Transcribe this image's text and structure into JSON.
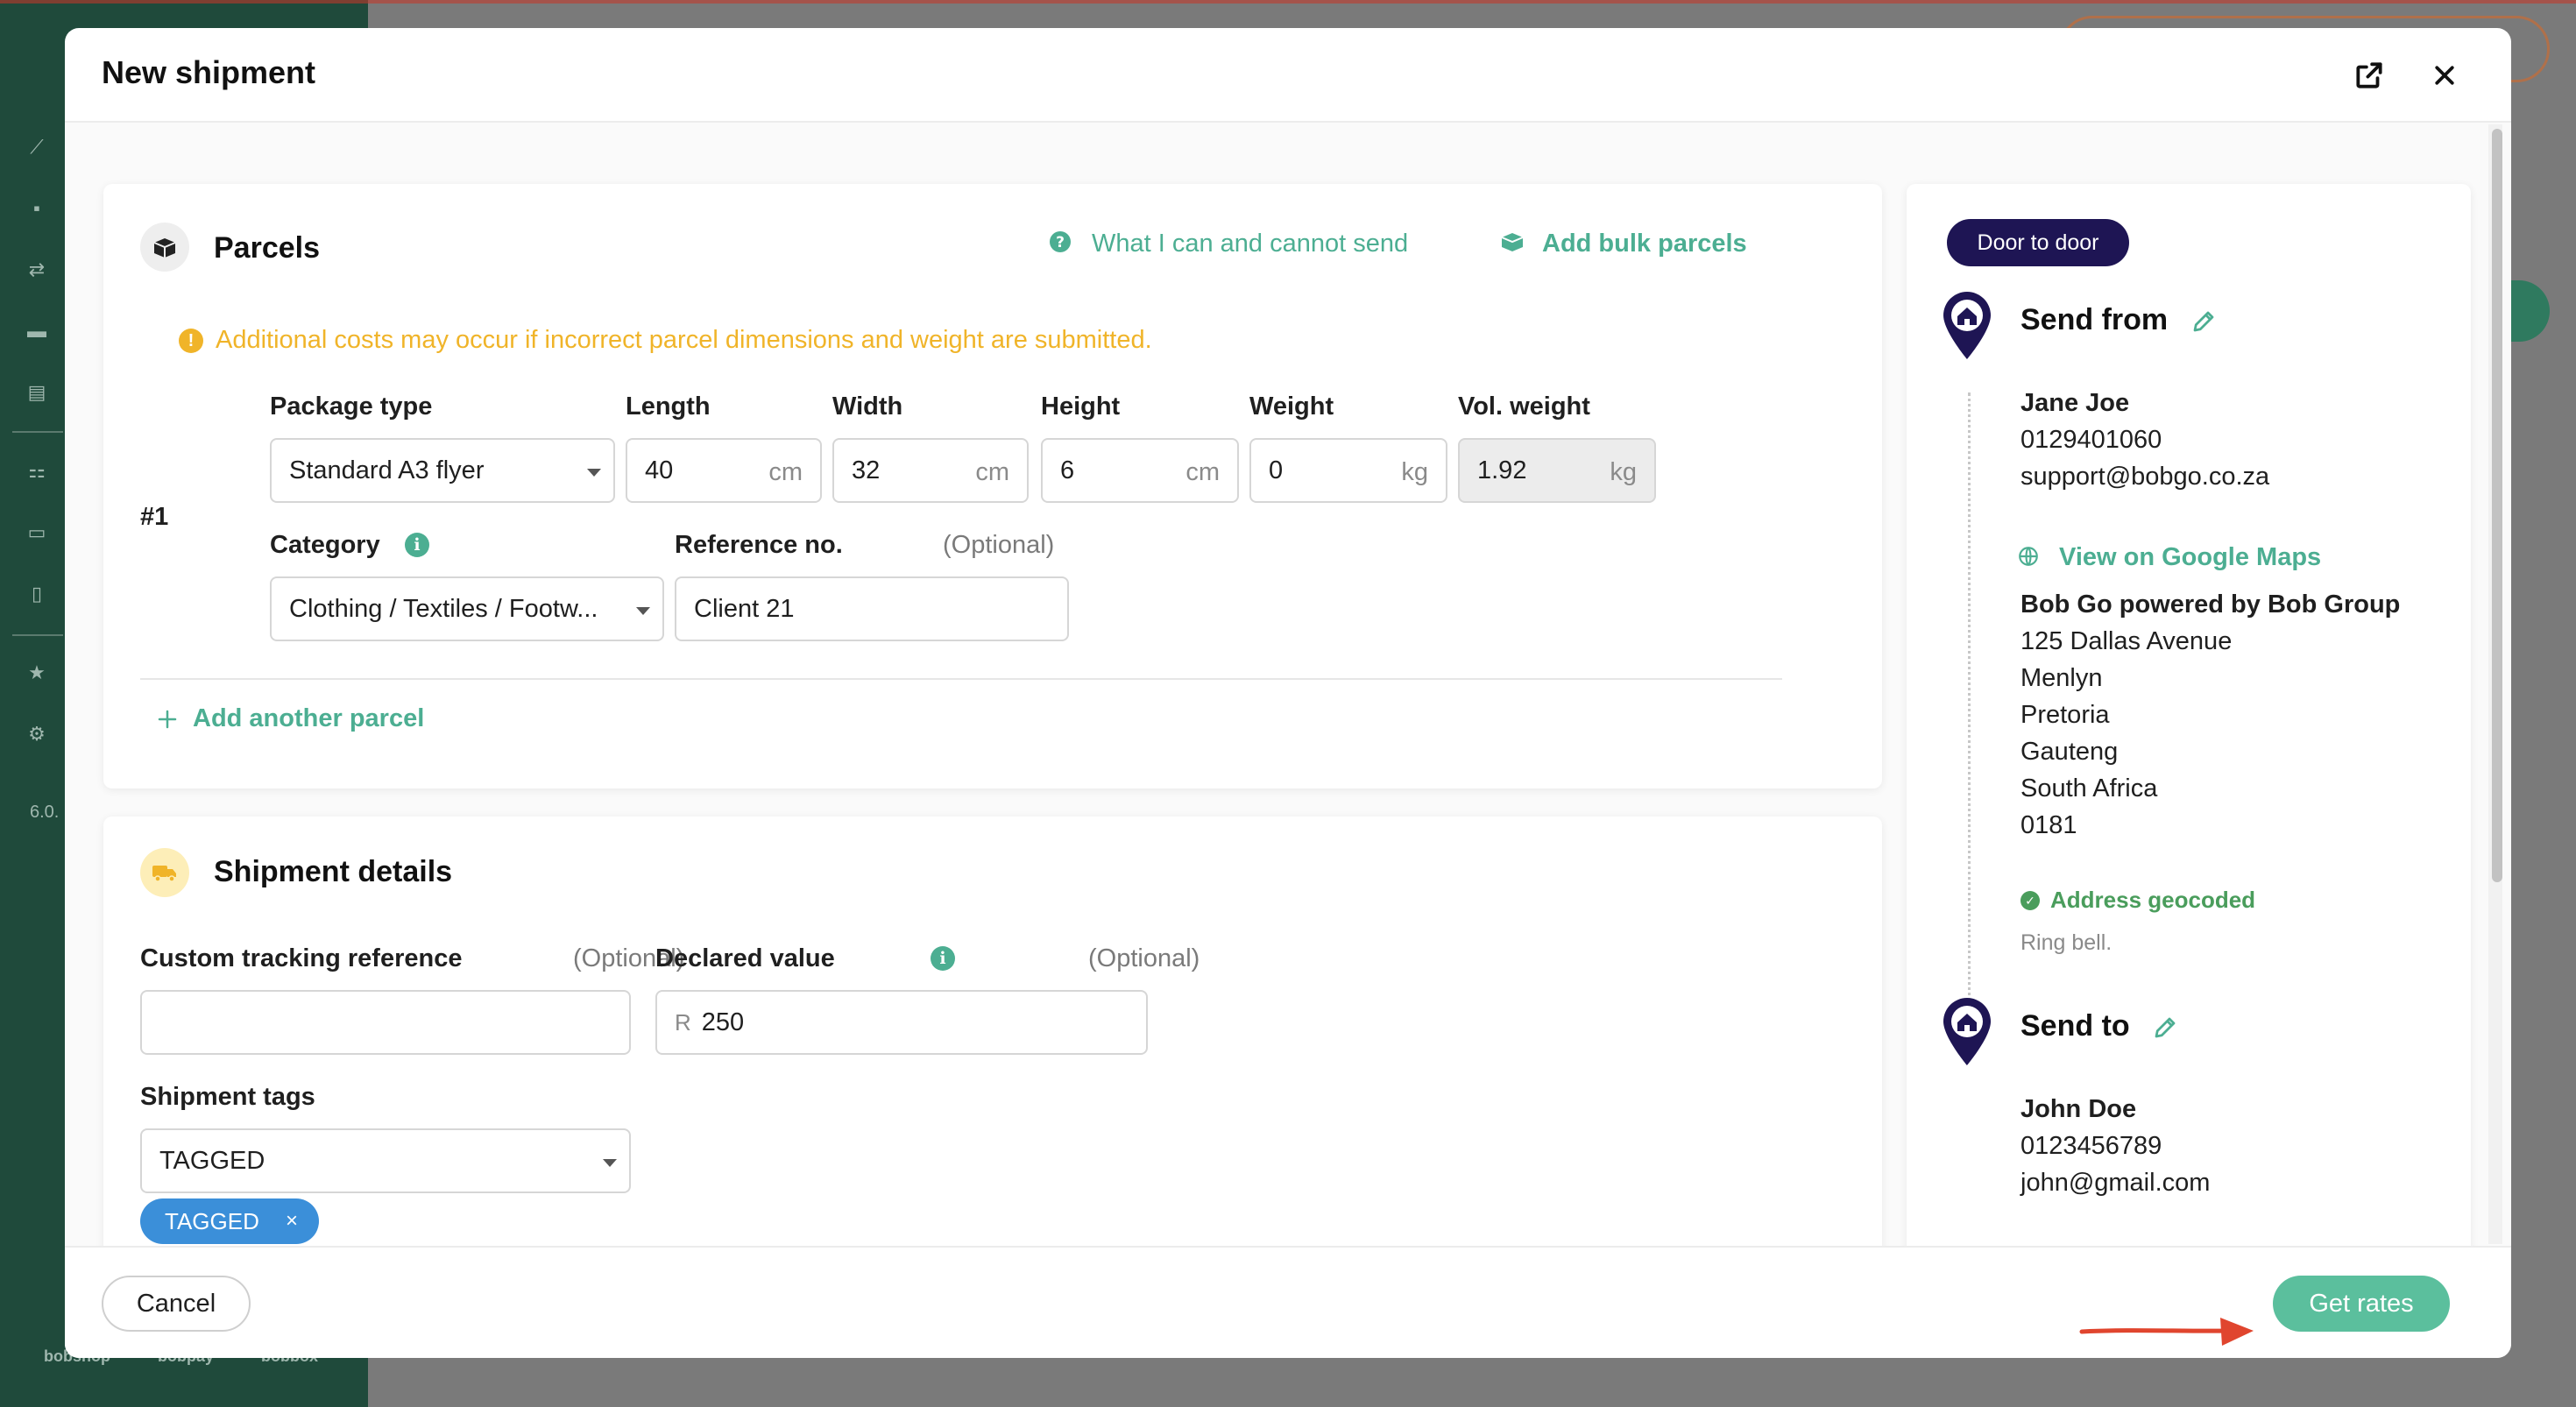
{
  "modal": {
    "title": "New shipment"
  },
  "parcels": {
    "title": "Parcels",
    "what_link": "What I can and cannot send",
    "bulk_link": "Add bulk parcels",
    "warning": "Additional costs may occur if incorrect parcel dimensions and weight are submitted.",
    "index": "#1",
    "labels": {
      "package_type": "Package type",
      "length": "Length",
      "width": "Width",
      "height": "Height",
      "weight": "Weight",
      "vol_weight": "Vol. weight",
      "category": "Category",
      "reference": "Reference no.",
      "optional": "(Optional)"
    },
    "values": {
      "package_type": "Standard A3 flyer",
      "length": "40",
      "width": "32",
      "height": "6",
      "weight": "0",
      "vol_weight": "1.92",
      "category": "Clothing / Textiles / Footw...",
      "reference": "Client 21"
    },
    "units": {
      "cm": "cm",
      "kg": "kg"
    },
    "add_another": "Add another parcel"
  },
  "shipment_details": {
    "title": "Shipment details",
    "labels": {
      "tracking": "Custom tracking reference",
      "declared": "Declared value",
      "optional": "(Optional)",
      "tags": "Shipment tags"
    },
    "values": {
      "tracking": "",
      "currency": "R",
      "declared": "250",
      "tags_select": "TAGGED",
      "tag_chip": "TAGGED",
      "tag_remove": "×"
    }
  },
  "route": {
    "service": "Door to door",
    "from": {
      "title": "Send from",
      "name": "Jane Joe",
      "phone": "0129401060",
      "email": "support@bobgo.co.za",
      "maps_link": "View on Google Maps",
      "company": "Bob Go powered by Bob Group",
      "street": "125 Dallas Avenue",
      "suburb": "Menlyn",
      "city": "Pretoria",
      "province": "Gauteng",
      "country": "South Africa",
      "postal": "0181",
      "geocoded": "Address geocoded",
      "note": "Ring bell."
    },
    "to": {
      "title": "Send to",
      "name": "John Doe",
      "phone": "0123456789",
      "email": "john@gmail.com"
    }
  },
  "footer": {
    "cancel": "Cancel",
    "get_rates": "Get rates"
  },
  "background": {
    "version": "6.0.",
    "brands": [
      "bobshop",
      "bobpay",
      "bobbox"
    ]
  },
  "colors": {
    "accent": "#4cae92",
    "primary_button": "#5bbf9d",
    "warning": "#f0b429",
    "service_pill": "#1e1554",
    "tag_chip": "#3b8fd9",
    "geocoded": "#4a9d5c",
    "annotation_arrow": "#e0452e"
  },
  "icons": {
    "external": "external-link-icon",
    "close": "close-icon",
    "parcels": "parcels-box-icon",
    "help": "help-circle-icon",
    "bulk": "boxes-icon",
    "warning": "warning-icon",
    "info": "info-icon",
    "plus": "plus-icon",
    "truck": "truck-icon",
    "pin": "home-pin-icon",
    "pencil": "pencil-icon",
    "globe": "globe-icon",
    "check": "check-circle-icon"
  }
}
